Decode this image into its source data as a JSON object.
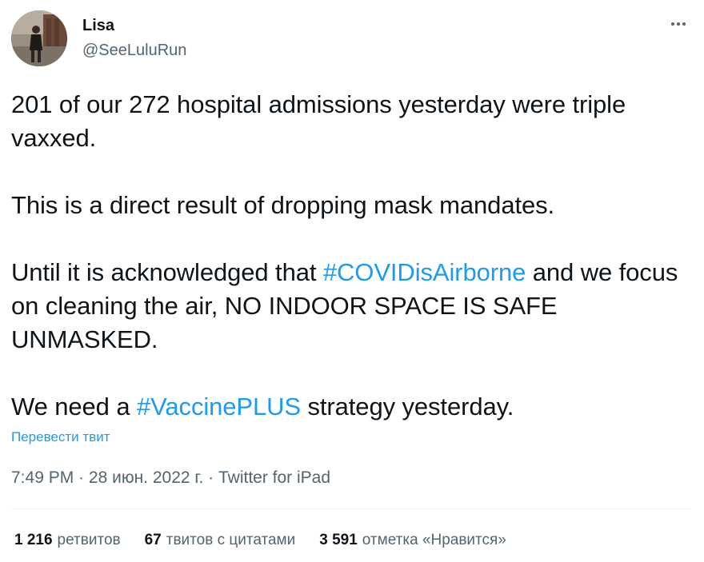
{
  "author": {
    "display_name": "Lisa",
    "handle": "@SeeLuluRun",
    "avatar_icon": "profile-photo-icon"
  },
  "more_icon": "more-horizontal-icon",
  "tweet": {
    "line1_a": "201 of our 272 hospital admissions yesterday were triple vaxxed.",
    "para2": "This is a direct result of dropping mask mandates.",
    "para3_before": "Until it is acknowledged that ",
    "para3_hashtag": "#COVIDisAirborne",
    "para3_after": " and we focus on cleaning the air, NO INDOOR SPACE IS SAFE UNMASKED.",
    "para4_before": "We need a ",
    "para4_hashtag": "#VaccinePLUS",
    "para4_after": " strategy yesterday."
  },
  "translate_label": "Перевести твит",
  "meta": {
    "time": "7:49 PM",
    "sep1": " · ",
    "date": "28 июн. 2022 г.",
    "sep2": " · ",
    "source": "Twitter for iPad"
  },
  "stats": {
    "retweets_count": "1 216",
    "retweets_label": "ретвитов",
    "quotes_count": "67",
    "quotes_label": "твитов с цитатами",
    "likes_count": "3 591",
    "likes_label": "отметка «Нравится»"
  },
  "colors": {
    "text": "#0f1419",
    "secondary": "#536471",
    "link": "#1d9bf0",
    "divider": "#eff3f4"
  }
}
